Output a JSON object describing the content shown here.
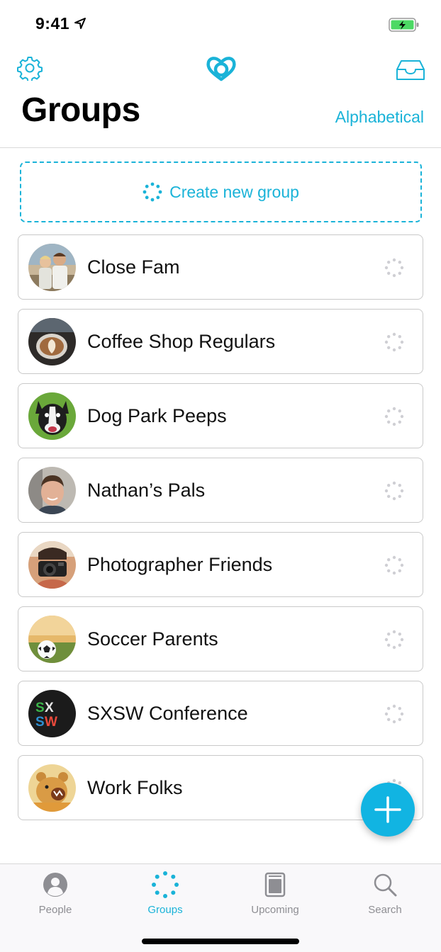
{
  "status_bar": {
    "time": "9:41"
  },
  "header": {
    "title": "Groups",
    "sort_label": "Alphabetical"
  },
  "create_group": {
    "label": "Create new group"
  },
  "groups": [
    {
      "name": "Close Fam",
      "avatar": "family-photo"
    },
    {
      "name": "Coffee Shop Regulars",
      "avatar": "latte-art-photo"
    },
    {
      "name": "Dog Park Peeps",
      "avatar": "boston-terrier-photo"
    },
    {
      "name": "Nathan’s Pals",
      "avatar": "man-portrait-photo"
    },
    {
      "name": "Photographer Friends",
      "avatar": "camera-person-photo"
    },
    {
      "name": "Soccer Parents",
      "avatar": "soccer-ball-photo"
    },
    {
      "name": "SXSW Conference",
      "avatar": "sxsw-logo"
    },
    {
      "name": "Work Folks",
      "avatar": "bear-illustration"
    }
  ],
  "tabs": [
    {
      "label": "People",
      "icon": "person-icon",
      "active": false
    },
    {
      "label": "Groups",
      "icon": "groups-dots-icon",
      "active": true
    },
    {
      "label": "Upcoming",
      "icon": "calendar-icon",
      "active": false
    },
    {
      "label": "Search",
      "icon": "search-icon",
      "active": false
    }
  ],
  "colors": {
    "accent": "#1ab3d8",
    "fab": "#11b4e2",
    "inactive": "#8e8e93",
    "battery": "#4cd964"
  }
}
